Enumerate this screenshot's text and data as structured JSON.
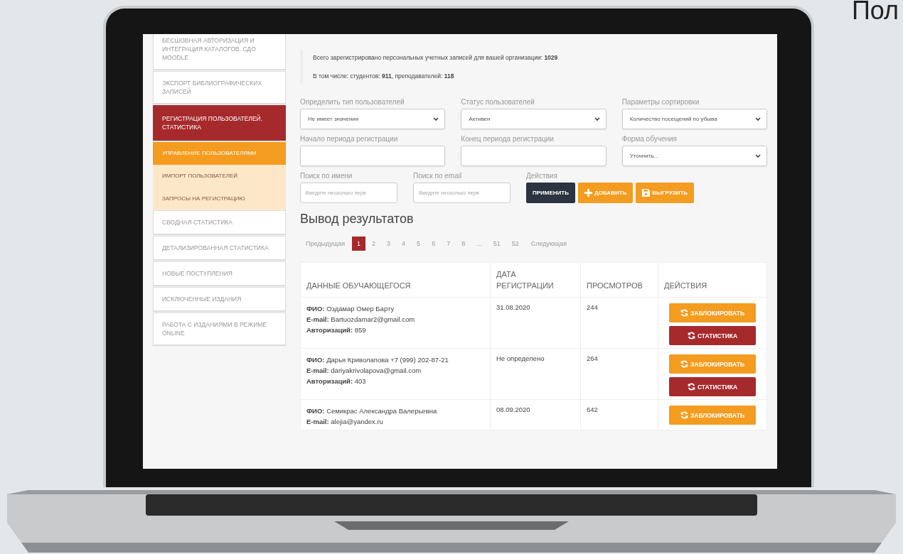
{
  "corner_text": "Пол",
  "sidebar": {
    "items": [
      {
        "label": "БЕСШОВНАЯ АВТОРИЗАЦИЯ И ИНТЕГРАЦИЯ КАТАЛОГОВ. СДО MOODLE",
        "kind": "section",
        "selected": false
      },
      {
        "label": "ЭКСПОРТ БИБЛИОГРАФИЧЕСКИХ ЗАПИСЕЙ",
        "kind": "section",
        "selected": false
      },
      {
        "label": "РЕГИСТРАЦИЯ ПОЛЬЗОВАТЕЛЕЙ. СТАТИСТИКА",
        "kind": "section",
        "selected": true
      },
      {
        "label": "УПРАВЛЕНИЕ ПОЛЬЗОВАТЕЛЯМИ",
        "kind": "subitem",
        "selected": true
      },
      {
        "label": "ИМПОРТ ПОЛЬЗОВАТЕЛЕЙ",
        "kind": "subitem",
        "selected": false
      },
      {
        "label": "ЗАПРОСЫ НА РЕГИСТРАЦИЮ",
        "kind": "subitem",
        "selected": false
      },
      {
        "label": "СВОДНАЯ СТАТИСТИКА",
        "kind": "section",
        "selected": false
      },
      {
        "label": "ДЕТАЛИЗИРОВАННАЯ СТАТИСТИКА",
        "kind": "section",
        "selected": false
      },
      {
        "label": "НОВЫЕ ПОСТУПЛЕНИЯ",
        "kind": "section",
        "selected": false
      },
      {
        "label": "ИСКЛЮЧЕННЫЕ ИЗДАНИЯ",
        "kind": "section",
        "selected": false
      },
      {
        "label": "РАБОТА С ИЗДАНИЯМИ В РЕЖИМЕ ONLINE",
        "kind": "section",
        "selected": false
      }
    ]
  },
  "summary": {
    "lines": [
      "Всего зарегистрировано персональных учетных записей для вашей организации: **1029**",
      "В том числе: студентов: **911**, преподавателей: **118**"
    ]
  },
  "filters": [
    {
      "label": "Определить тип пользователей",
      "kind": "select",
      "value": "Не имеет значения"
    },
    {
      "label": "Статус пользователей",
      "kind": "select",
      "value": "Активен"
    },
    {
      "label": "Параметры сортировки",
      "kind": "select",
      "value": "Количество посещений по убыва"
    },
    {
      "label": "Начало периода регистрации",
      "kind": "text"
    },
    {
      "label": "Конец периода регистрации",
      "kind": "text"
    },
    {
      "label": "Форма обучения",
      "kind": "select",
      "value": "Уточнить..."
    }
  ],
  "search": [
    {
      "label": "Поиск по имени",
      "placeholder": "Введите несколько перв"
    },
    {
      "label": "Поиск по email",
      "placeholder": "Введите несколько перв"
    }
  ],
  "actions": {
    "label": "Действия",
    "buttons": [
      {
        "label": "ПРИМЕНИТЬ",
        "kind": "apply"
      },
      {
        "label": "ДОБАВИТЬ",
        "kind": "add"
      },
      {
        "label": "ВЫГРУЗИТЬ",
        "kind": "export"
      }
    ]
  },
  "results": {
    "title": "Вывод результатов",
    "pagination": {
      "previous": "Предыдущая",
      "next": "Следующая",
      "pages": [
        {
          "label": "1",
          "selected": true
        },
        {
          "label": "2",
          "selected": false
        },
        {
          "label": "3",
          "selected": false
        },
        {
          "label": "4",
          "selected": false
        },
        {
          "label": "5",
          "selected": false
        },
        {
          "label": "6",
          "selected": false
        },
        {
          "label": "7",
          "selected": false
        },
        {
          "label": "8",
          "selected": false
        },
        {
          "label": "...",
          "selected": false
        },
        {
          "label": "51",
          "selected": false
        },
        {
          "label": "52",
          "selected": false
        }
      ]
    },
    "table": {
      "columns": [
        "ДАННЫЕ ОБУЧАЮЩЕГОСЯ",
        "ДАТА РЕГИСТРАЦИИ",
        "ПРОСМОТРОВ",
        "ДЕЙСТВИЯ"
      ],
      "rows": [
        {
          "student": [
            "**ФИО:** Оздамар Омер Барту",
            "**E-mail:** Bartuozdamar2@gmail.com",
            "**Авторизаций:** 859"
          ],
          "date": "31.08.2020",
          "views": "244",
          "actions": [
            {
              "label": "ЗАБЛОКИРОВАТЬ",
              "kind": "block"
            },
            {
              "label": "СТАТИСТИКА",
              "kind": "stats"
            }
          ]
        },
        {
          "student": [
            "**ФИО:** Дарья Криволапова +7 (999) 202-87-21",
            "**E-mail:** dariyakrivolapova@gmail.com",
            "**Авторизаций:** 403"
          ],
          "date": "Не определено",
          "views": "264",
          "actions": [
            {
              "label": "ЗАБЛОКИРОВАТЬ",
              "kind": "block"
            },
            {
              "label": "СТАТИСТИКА",
              "kind": "stats"
            }
          ]
        },
        {
          "student": [
            "**ФИО:** Семикрас Александра Валерьевна",
            "**E-mail:** alejia@yandex.ru"
          ],
          "date": "08.09.2020",
          "views": "642",
          "actions": [
            {
              "label": "ЗАБЛОКИРОВАТЬ",
              "kind": "block"
            }
          ]
        }
      ]
    }
  }
}
